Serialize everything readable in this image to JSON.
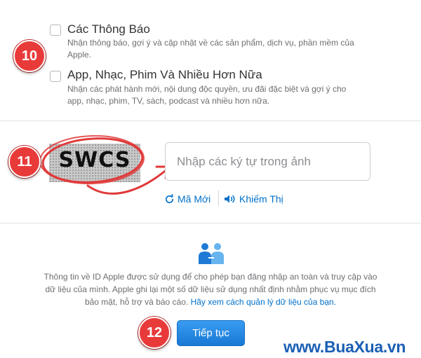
{
  "options": [
    {
      "title": "Các Thông Báo",
      "description": "Nhận thông báo, gợi ý và cập nhật về các sản phẩm, dịch vụ, phần mềm của Apple.",
      "checked": false
    },
    {
      "title": "App, Nhạc, Phim Và Nhiều Hơn Nữa",
      "description": "Nhận các phát hành mới, nội dung độc quyền, ưu đãi đặc biệt và gợi ý cho app, nhạc, phim, TV, sách, podcast và nhiều hơn nữa.",
      "checked": false
    }
  ],
  "badges": {
    "step10": "10",
    "step11": "11",
    "step12": "12"
  },
  "captcha": {
    "image_text": "SWCS",
    "input_placeholder": "Nhập các ký tự trong ảnh",
    "input_value": "",
    "new_code_label": "Mã Mới",
    "audio_label": "Khiếm Thị"
  },
  "privacy": {
    "text": "Thông tin về ID Apple được sử dụng để cho phép bạn đăng nhập an toàn và truy cập vào dữ liệu của mình. Apple ghi lại một số dữ liệu sử dụng nhất định nhằm phục vụ mục đích bảo mật, hỗ trợ và báo cáo.",
    "link": "Hãy xem cách quản lý dữ liệu của bạn."
  },
  "continue_label": "Tiếp tục",
  "watermark": "www.BuaXua.vn",
  "colors": {
    "accent": "#0070c9",
    "badge_red": "#e93a3a",
    "button_blue": "#1779d4",
    "annotation_red": "#e03a3a"
  }
}
